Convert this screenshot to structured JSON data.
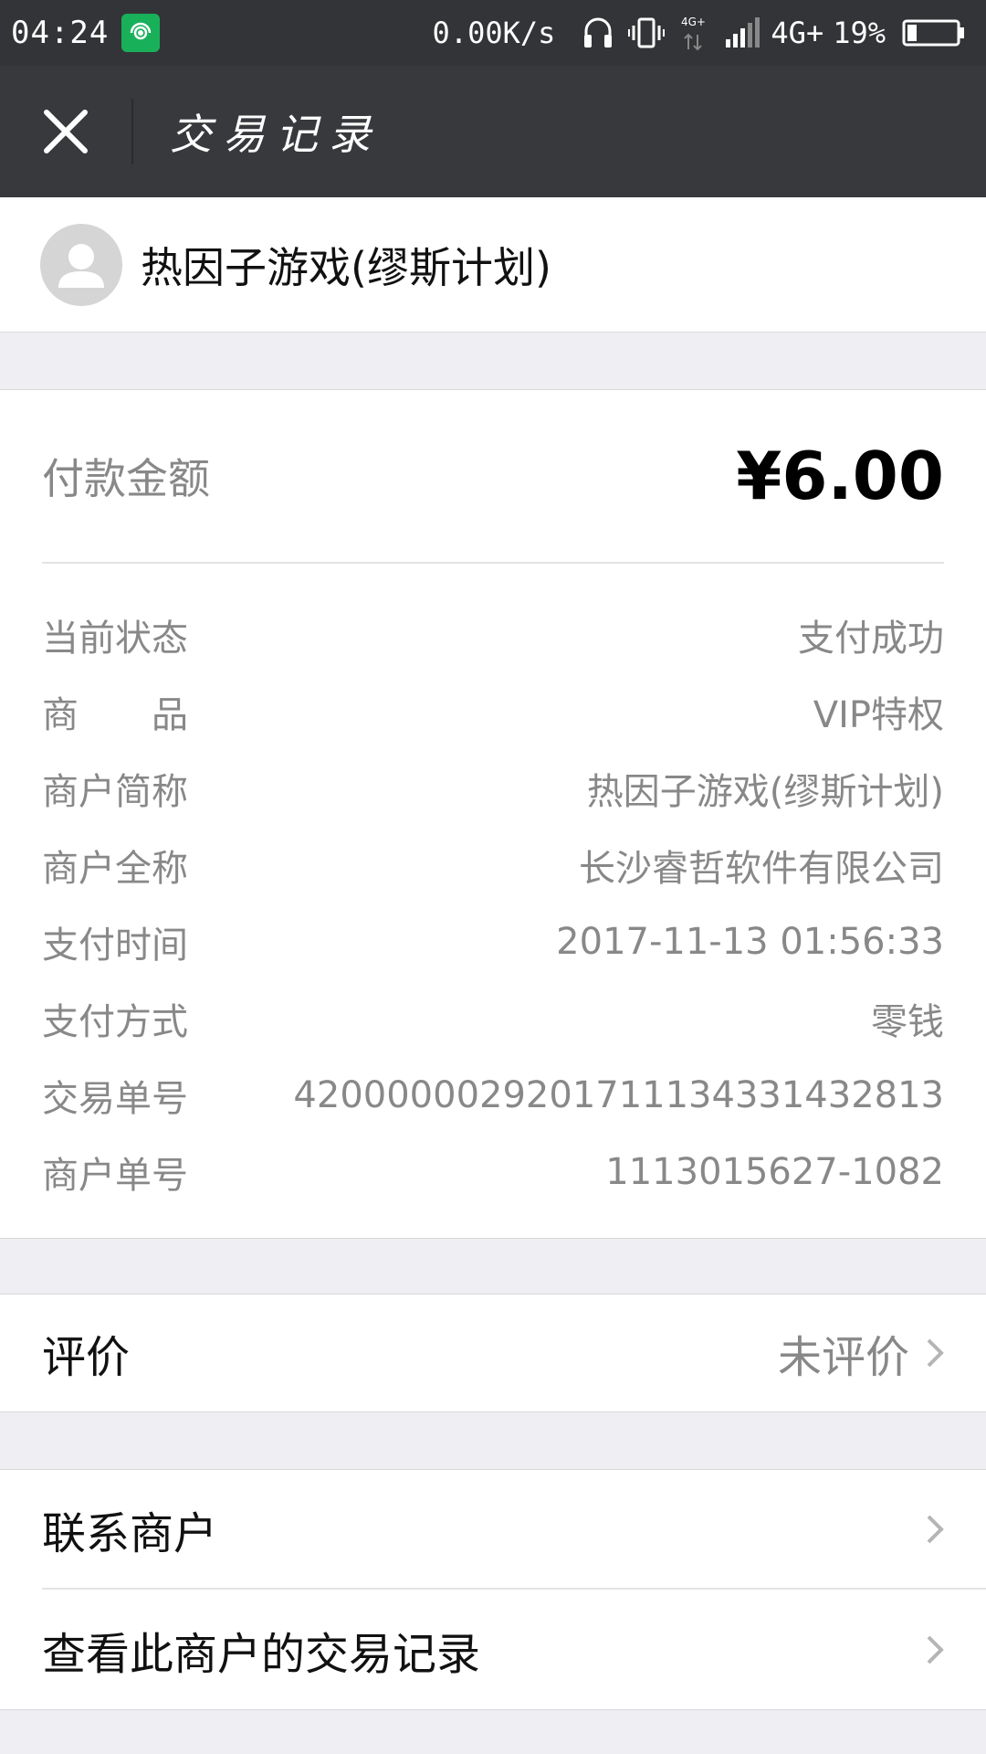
{
  "status_bar": {
    "time": "04:24",
    "network_speed": "0.00K/s",
    "network_type": "4G+",
    "signal_small_label": "4G+",
    "battery_percent": "19%",
    "battery_level": 0.19
  },
  "title_bar": {
    "title": "交易记录",
    "close_icon": "close-icon"
  },
  "merchant": {
    "name": "热因子游戏(缪斯计划)",
    "avatar_icon": "user-avatar-icon"
  },
  "payment": {
    "amount_label": "付款金额",
    "amount_value": "¥6.00"
  },
  "details": [
    {
      "label": "当前状态",
      "value": "支付成功"
    },
    {
      "label": "商　　品",
      "value": "VIP特权"
    },
    {
      "label": "商户简称",
      "value": "热因子游戏(缪斯计划)"
    },
    {
      "label": "商户全称",
      "value": "长沙睿哲软件有限公司"
    },
    {
      "label": "支付时间",
      "value": "2017-11-13 01:56:33"
    },
    {
      "label": "支付方式",
      "value": "零钱"
    },
    {
      "label": "交易单号",
      "value": "4200000029201711134331432813"
    },
    {
      "label": "商户单号",
      "value": "1113015627-1082"
    }
  ],
  "review": {
    "label": "评价",
    "status": "未评价"
  },
  "actions": [
    {
      "label": "联系商户"
    },
    {
      "label": "查看此商户的交易记录"
    }
  ],
  "colors": {
    "status_bar_bg": "#333437",
    "title_bar_bg": "#38393d",
    "page_bg": "#eeeef3",
    "app_icon_green": "#19b05a"
  }
}
